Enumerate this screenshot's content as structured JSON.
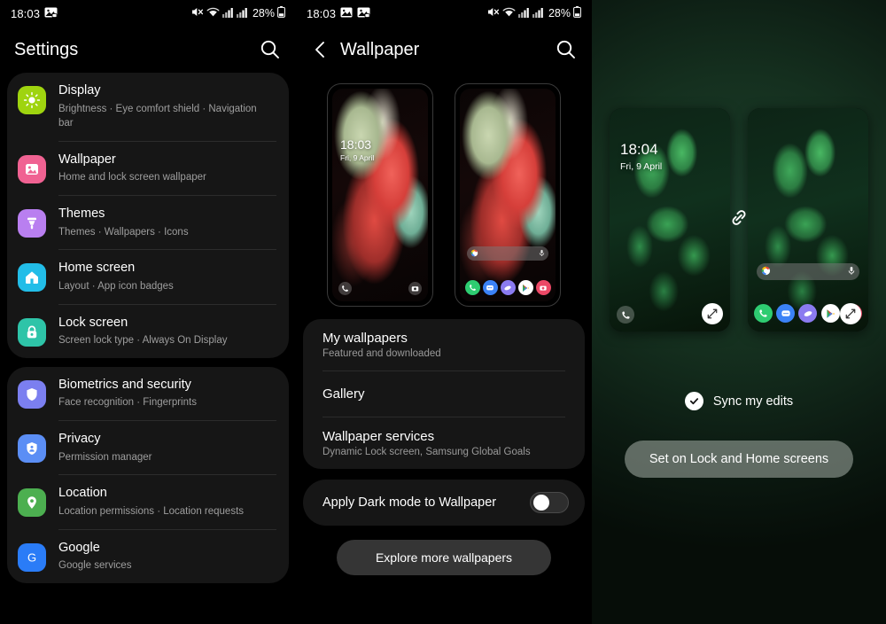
{
  "status_bar": {
    "time_left": "18:03",
    "time_middle": "18:03",
    "battery_pct": "28%",
    "icons": [
      "image-icon",
      "screenshot-icon",
      "mute-icon",
      "wifi-icon",
      "signal-icon",
      "signal-icon-2",
      "battery-icon"
    ]
  },
  "settings_panel": {
    "title": "Settings",
    "search_icon": "search-icon",
    "groups": [
      {
        "items": [
          {
            "title": "Display",
            "subtitle": "Brightness  ·  Eye comfort shield  ·  Navigation bar",
            "icon": "brightness-icon",
            "color": "#9fd40f"
          },
          {
            "title": "Wallpaper",
            "subtitle": "Home and lock screen wallpaper",
            "icon": "image-icon",
            "color": "#f06292"
          },
          {
            "title": "Themes",
            "subtitle": "Themes  ·  Wallpapers  ·  Icons",
            "icon": "theme-icon",
            "color": "#b97ff0"
          },
          {
            "title": "Home screen",
            "subtitle": "Layout  ·  App icon badges",
            "icon": "home-icon",
            "color": "#22bde8"
          },
          {
            "title": "Lock screen",
            "subtitle": "Screen lock type  ·  Always On Display",
            "icon": "lock-icon",
            "color": "#2ec4a8"
          }
        ]
      },
      {
        "items": [
          {
            "title": "Biometrics and security",
            "subtitle": "Face recognition  ·  Fingerprints",
            "icon": "shield-icon",
            "color": "#7b7ff0"
          },
          {
            "title": "Privacy",
            "subtitle": "Permission manager",
            "icon": "privacy-shield-icon",
            "color": "#5b8ef5"
          },
          {
            "title": "Location",
            "subtitle": "Location permissions  ·  Location requests",
            "icon": "location-pin-icon",
            "color": "#4caf50"
          },
          {
            "title": "Google",
            "subtitle": "Google services",
            "icon": "google-g-icon",
            "color": "#2a7cf7"
          }
        ]
      }
    ]
  },
  "wallpaper_panel": {
    "title": "Wallpaper",
    "back_icon": "chevron-left-icon",
    "search_icon": "search-icon",
    "lock_preview": {
      "time": "18:03",
      "date": "Fri, 9 April",
      "left_icon": "phone-icon",
      "right_icon": "camera-icon"
    },
    "home_preview": {
      "search_left_icon": "google-icon",
      "search_right_icon": "microphone-icon",
      "dock": [
        "phone-icon",
        "messages-icon",
        "internet-icon",
        "play-store-icon",
        "camera-icon"
      ]
    },
    "menu": [
      {
        "title": "My wallpapers",
        "subtitle": "Featured and downloaded"
      },
      {
        "title": "Gallery",
        "subtitle": ""
      },
      {
        "title": "Wallpaper services",
        "subtitle": "Dynamic Lock screen, Samsung Global Goals"
      }
    ],
    "dark_mode_toggle": {
      "label": "Apply Dark mode to Wallpaper",
      "state": "off"
    },
    "explore_button": "Explore more wallpapers"
  },
  "apply_panel": {
    "lock_preview": {
      "time": "18:04",
      "date": "Fri, 9 April",
      "left_icon": "phone-icon",
      "edit_icon": "expand-icon"
    },
    "home_preview": {
      "search_left_icon": "google-icon",
      "search_right_icon": "microphone-icon",
      "dock": [
        "phone-icon",
        "messages-icon",
        "internet-icon",
        "play-store-icon",
        "camera-icon"
      ],
      "edit_icon": "expand-icon"
    },
    "link_icon": "link-icon",
    "sync_label": "Sync my edits",
    "sync_checked": true,
    "set_button": "Set on Lock and Home screens"
  }
}
